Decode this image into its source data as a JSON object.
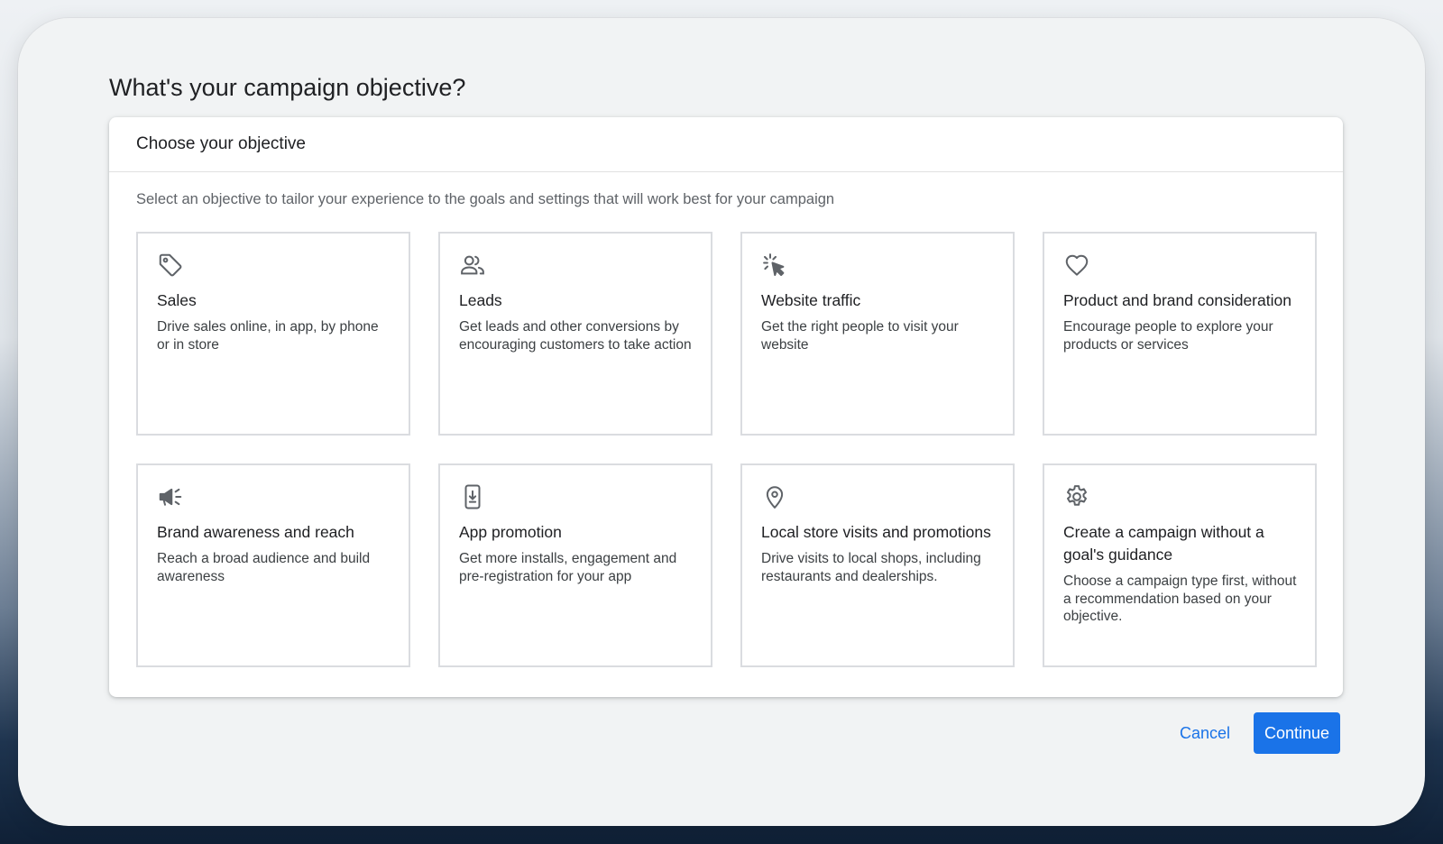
{
  "page": {
    "title": "What's your campaign objective?"
  },
  "card": {
    "title": "Choose your objective",
    "subtitle": "Select an objective to tailor your experience to the goals and settings that will work best for your campaign"
  },
  "objectives": [
    {
      "icon": "tag-icon",
      "title": "Sales",
      "description": "Drive sales online, in app, by phone or in store"
    },
    {
      "icon": "people-icon",
      "title": "Leads",
      "description": "Get leads and other conversions by encouraging customers to take action"
    },
    {
      "icon": "cursor-click-icon",
      "title": "Website traffic",
      "description": "Get the right people to visit your website"
    },
    {
      "icon": "heart-icon",
      "title": "Product and brand consideration",
      "description": "Encourage people to explore your products or services"
    },
    {
      "icon": "megaphone-icon",
      "title": "Brand awareness and reach",
      "description": "Reach a broad audience and build awareness"
    },
    {
      "icon": "phone-download-icon",
      "title": "App promotion",
      "description": "Get more installs, engagement and pre-registration for your app"
    },
    {
      "icon": "location-pin-icon",
      "title": "Local store visits and promotions",
      "description": "Drive visits to local shops, including restaurants and dealerships."
    },
    {
      "icon": "gear-icon",
      "title": "Create a campaign without a goal's guidance",
      "description": "Choose a campaign type first, without a recommendation based on your objective."
    }
  ],
  "actions": {
    "cancel_label": "Cancel",
    "continue_label": "Continue"
  },
  "colors": {
    "accent": "#1a73e8",
    "text_primary": "#202124",
    "text_secondary": "#5f6368",
    "tile_border": "#dadce0",
    "icon": "#5f6368"
  }
}
